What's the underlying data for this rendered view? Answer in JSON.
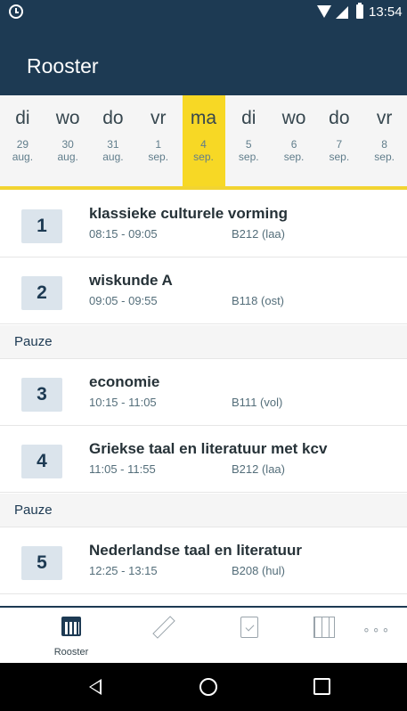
{
  "status_bar": {
    "time": "13:54"
  },
  "app_bar": {
    "title": "Rooster"
  },
  "days": [
    {
      "name": "di",
      "num": "29",
      "month": "aug.",
      "selected": false
    },
    {
      "name": "wo",
      "num": "30",
      "month": "aug.",
      "selected": false
    },
    {
      "name": "do",
      "num": "31",
      "month": "aug.",
      "selected": false
    },
    {
      "name": "vr",
      "num": "1",
      "month": "sep.",
      "selected": false
    },
    {
      "name": "ma",
      "num": "4",
      "month": "sep.",
      "selected": true
    },
    {
      "name": "di",
      "num": "5",
      "month": "sep.",
      "selected": false
    },
    {
      "name": "wo",
      "num": "6",
      "month": "sep.",
      "selected": false
    },
    {
      "name": "do",
      "num": "7",
      "month": "sep.",
      "selected": false
    },
    {
      "name": "vr",
      "num": "8",
      "month": "sep.",
      "selected": false
    }
  ],
  "schedule": [
    {
      "kind": "lesson",
      "hour": "1",
      "subject": "klassieke culturele vorming",
      "time": "08:15 - 09:05",
      "room": "B212 (laa)"
    },
    {
      "kind": "lesson",
      "hour": "2",
      "subject": "wiskunde A",
      "time": "09:05 - 09:55",
      "room": "B118 (ost)"
    },
    {
      "kind": "break",
      "label": "Pauze"
    },
    {
      "kind": "lesson",
      "hour": "3",
      "subject": "economie",
      "time": "10:15 - 11:05",
      "room": "B111 (vol)"
    },
    {
      "kind": "lesson",
      "hour": "4",
      "subject": "Griekse taal en literatuur met kcv",
      "time": "11:05 - 11:55",
      "room": "B212 (laa)"
    },
    {
      "kind": "break",
      "label": "Pauze"
    },
    {
      "kind": "lesson",
      "hour": "5",
      "subject": "Nederlandse taal en literatuur",
      "time": "12:25 - 13:15",
      "room": "B208 (hul)"
    }
  ],
  "bottom_nav": {
    "items": [
      {
        "icon": "calendar-icon",
        "label": "Rooster",
        "active": true
      },
      {
        "icon": "pencil-icon",
        "label": "",
        "active": false
      },
      {
        "icon": "checklist-icon",
        "label": "",
        "active": false
      },
      {
        "icon": "grades-grid-icon",
        "label": "",
        "active": false
      },
      {
        "icon": "more-icon",
        "label": "",
        "active": false
      }
    ]
  },
  "colors": {
    "primary": "#1d3a53",
    "accent": "#f7d825",
    "badge_bg": "#dbe4ec"
  }
}
